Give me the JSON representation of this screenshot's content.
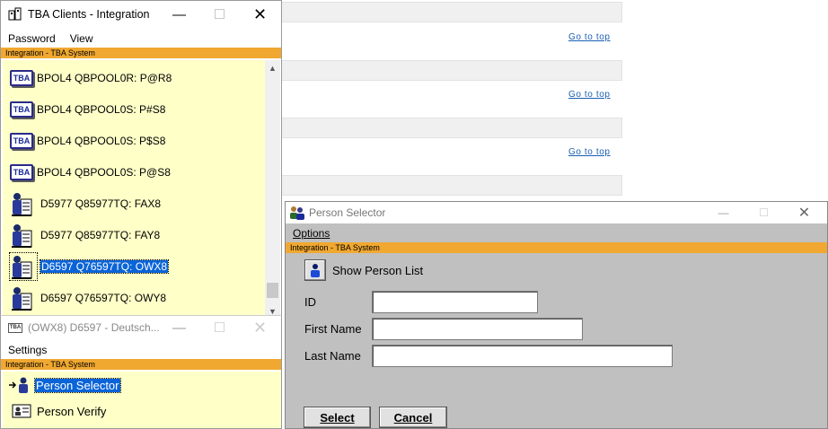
{
  "background_page": {
    "links": [
      "Go to top",
      "Go to top",
      "Go to top"
    ]
  },
  "clients_window": {
    "title": "TBA Clients - Integration",
    "menu": [
      "Password",
      "View"
    ],
    "banner": "Integration -  TBA System",
    "icon_text": "TBA",
    "items": [
      {
        "label": "BPOL4 QBPOOL0R: P@R8",
        "icon": "tba-icon"
      },
      {
        "label": "BPOL4 QBPOOL0S: P#S8",
        "icon": "tba-icon"
      },
      {
        "label": "BPOL4 QBPOOL0S: P$S8",
        "icon": "tba-icon"
      },
      {
        "label": "BPOL4 QBPOOL0S: P@S8",
        "icon": "tba-icon"
      },
      {
        "label": "D5977 Q85977TQ: FAX8",
        "icon": "person-building-icon"
      },
      {
        "label": "D5977 Q85977TQ: FAY8",
        "icon": "person-building-icon"
      },
      {
        "label": "D6597 Q76597TQ: OWX8",
        "icon": "person-building-icon",
        "selected": true
      },
      {
        "label": "D6597 Q76597TQ: OWY8",
        "icon": "person-building-icon"
      }
    ]
  },
  "deutsch_window": {
    "title": "(OWX8) D6597 - Deutsch...",
    "menu": [
      "Settings"
    ],
    "banner": "Integration -  TBA System",
    "items": [
      {
        "label": "Person Selector",
        "icon": "arrow-person-icon",
        "selected": true
      },
      {
        "label": "Person Verify",
        "icon": "id-card-icon"
      }
    ]
  },
  "person_selector": {
    "title": "Person Selector",
    "menu": [
      "Options"
    ],
    "banner": "Integration -  TBA System",
    "show_list_label": "Show Person List",
    "fields": {
      "id_label": "ID",
      "id_value": "",
      "first_label": "First Name",
      "first_value": "",
      "last_label": "Last Name",
      "last_value": ""
    },
    "select_label": "Select",
    "cancel_label": "Cancel"
  },
  "colors": {
    "banner": "#f0a830",
    "list_bg": "#ffffc8",
    "selection": "#0a64d8",
    "dialog_bg": "#c0c0c0"
  }
}
